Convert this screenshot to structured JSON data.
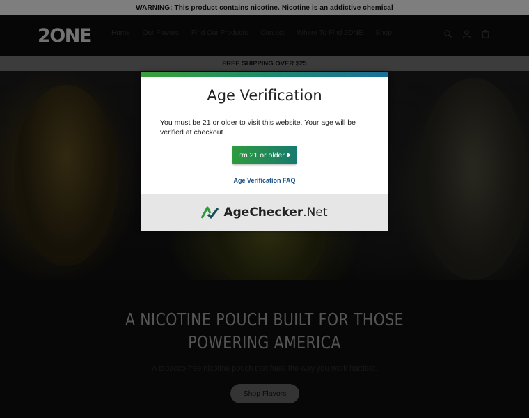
{
  "warning": "WARNING: This product contains nicotine. Nicotine is an addictive chemical",
  "logo": "2ONE",
  "nav": {
    "items": [
      "Home",
      "Our Flavors",
      "Find Our Products",
      "Contact",
      "Where To Find 2ONE",
      "Shop"
    ]
  },
  "header_icons": [
    "search-icon",
    "account-icon",
    "cart-icon"
  ],
  "shipping": "FREE SHIPPING OVER $25",
  "hero": {
    "heading_line1": "A NICOTINE POUCH BUILT FOR THOSE",
    "heading_line2": "POWERING AMERICA",
    "subheading": "A tobacco-free nicotine pouch that fuels the way you work hardest.",
    "cta": "Shop Flavors"
  },
  "modal": {
    "title": "Age Verification",
    "message": "You must be 21 or older to visit this website. Your age will be verified at checkout.",
    "confirm_label": "I'm 21 or older",
    "faq_label": "Age Verification FAQ",
    "brand_bold": "AgeChecker",
    "brand_rest": ".Net"
  },
  "colors": {
    "accent_green": "#2e9a3e",
    "accent_teal": "#187a6e",
    "link_blue": "#1b4f86"
  }
}
